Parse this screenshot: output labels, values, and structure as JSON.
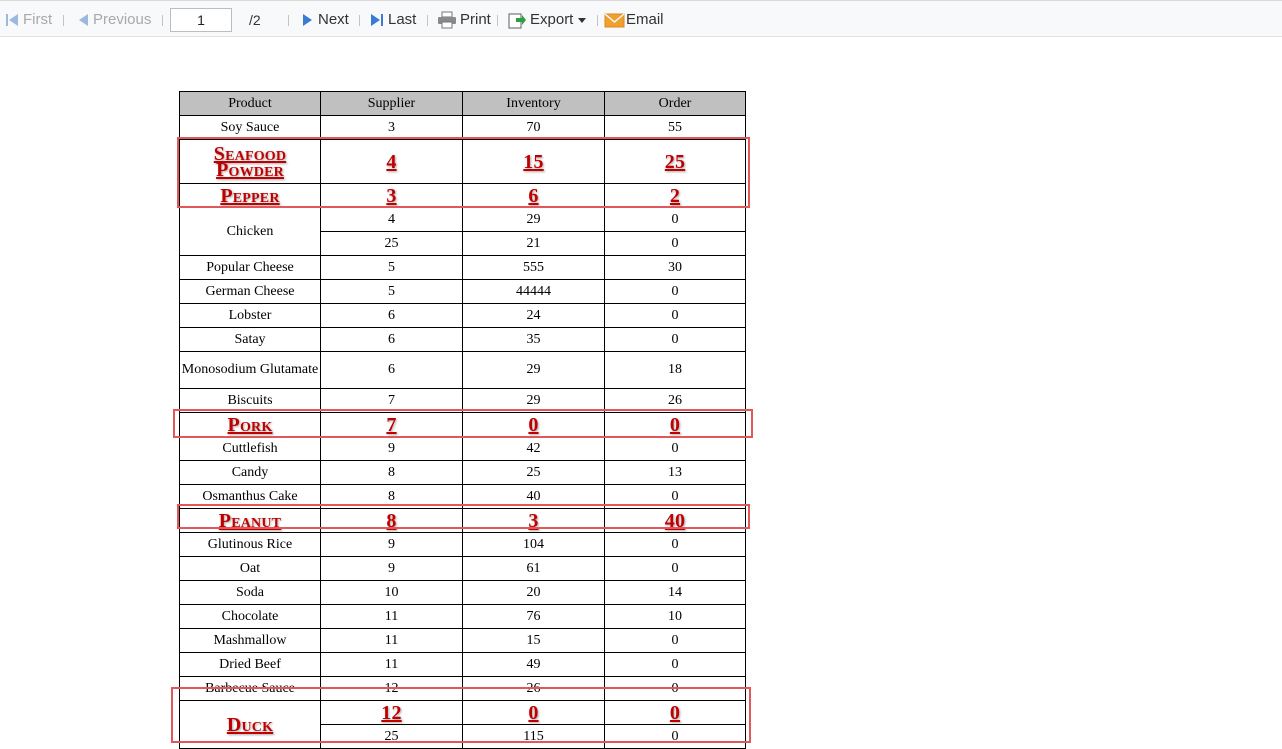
{
  "toolbar": {
    "first_label": "First",
    "previous_label": "Previous",
    "page_value": "1",
    "page_total": "/2",
    "next_label": "Next",
    "last_label": "Last",
    "print_label": "Print",
    "export_label": "Export",
    "email_label": "Email"
  },
  "table": {
    "headers": [
      "Product",
      "Supplier",
      "Inventory",
      "Order"
    ],
    "rows": [
      {
        "product": "Soy Sauce",
        "supplier": "3",
        "inventory": "70",
        "order": "55"
      },
      {
        "product": "Seafood Powder",
        "supplier": "4",
        "inventory": "15",
        "order": "25",
        "highlight": true
      },
      {
        "product": "Pepper",
        "supplier": "3",
        "inventory": "6",
        "order": "2",
        "highlight": true
      },
      {
        "product": "Chicken",
        "supplier": "4",
        "inventory": "29",
        "order": "0"
      },
      {
        "product": "",
        "supplier": "25",
        "inventory": "21",
        "order": "0"
      },
      {
        "product": "Popular Cheese",
        "supplier": "5",
        "inventory": "555",
        "order": "30"
      },
      {
        "product": "German Cheese",
        "supplier": "5",
        "inventory": "44444",
        "order": "0"
      },
      {
        "product": "Lobster",
        "supplier": "6",
        "inventory": "24",
        "order": "0"
      },
      {
        "product": "Satay",
        "supplier": "6",
        "inventory": "35",
        "order": "0"
      },
      {
        "product": "Monosodium Glutamate",
        "supplier": "6",
        "inventory": "29",
        "order": "18"
      },
      {
        "product": "Biscuits",
        "supplier": "7",
        "inventory": "29",
        "order": "26"
      },
      {
        "product": "Pork",
        "supplier": "7",
        "inventory": "0",
        "order": "0",
        "highlight": true
      },
      {
        "product": "Cuttlefish",
        "supplier": "9",
        "inventory": "42",
        "order": "0"
      },
      {
        "product": "Candy",
        "supplier": "8",
        "inventory": "25",
        "order": "13"
      },
      {
        "product": "Osmanthus Cake",
        "supplier": "8",
        "inventory": "40",
        "order": "0"
      },
      {
        "product": "Peanut",
        "supplier": "8",
        "inventory": "3",
        "order": "40",
        "highlight": true
      },
      {
        "product": "Glutinous Rice",
        "supplier": "9",
        "inventory": "104",
        "order": "0"
      },
      {
        "product": "Oat",
        "supplier": "9",
        "inventory": "61",
        "order": "0"
      },
      {
        "product": "Soda",
        "supplier": "10",
        "inventory": "20",
        "order": "14"
      },
      {
        "product": "Chocolate",
        "supplier": "11",
        "inventory": "76",
        "order": "10"
      },
      {
        "product": "Mashmallow",
        "supplier": "11",
        "inventory": "15",
        "order": "0"
      },
      {
        "product": "Dried Beef",
        "supplier": "11",
        "inventory": "49",
        "order": "0"
      },
      {
        "product": "Barbecue Sauce",
        "supplier": "12",
        "inventory": "26",
        "order": "0"
      },
      {
        "product": "Duck",
        "supplier": "12",
        "inventory": "0",
        "order": "0",
        "highlight": true
      },
      {
        "product": "",
        "supplier": "25",
        "inventory": "115",
        "order": "0"
      }
    ]
  },
  "colors": {
    "highlight_text": "#c00000",
    "highlight_box": "#e0585a",
    "header_bg": "#c0c0c0",
    "toolbar_bg": "#f8f9fa",
    "icon_blue": "#3a7bd5",
    "email_orange": "#f0a030"
  }
}
